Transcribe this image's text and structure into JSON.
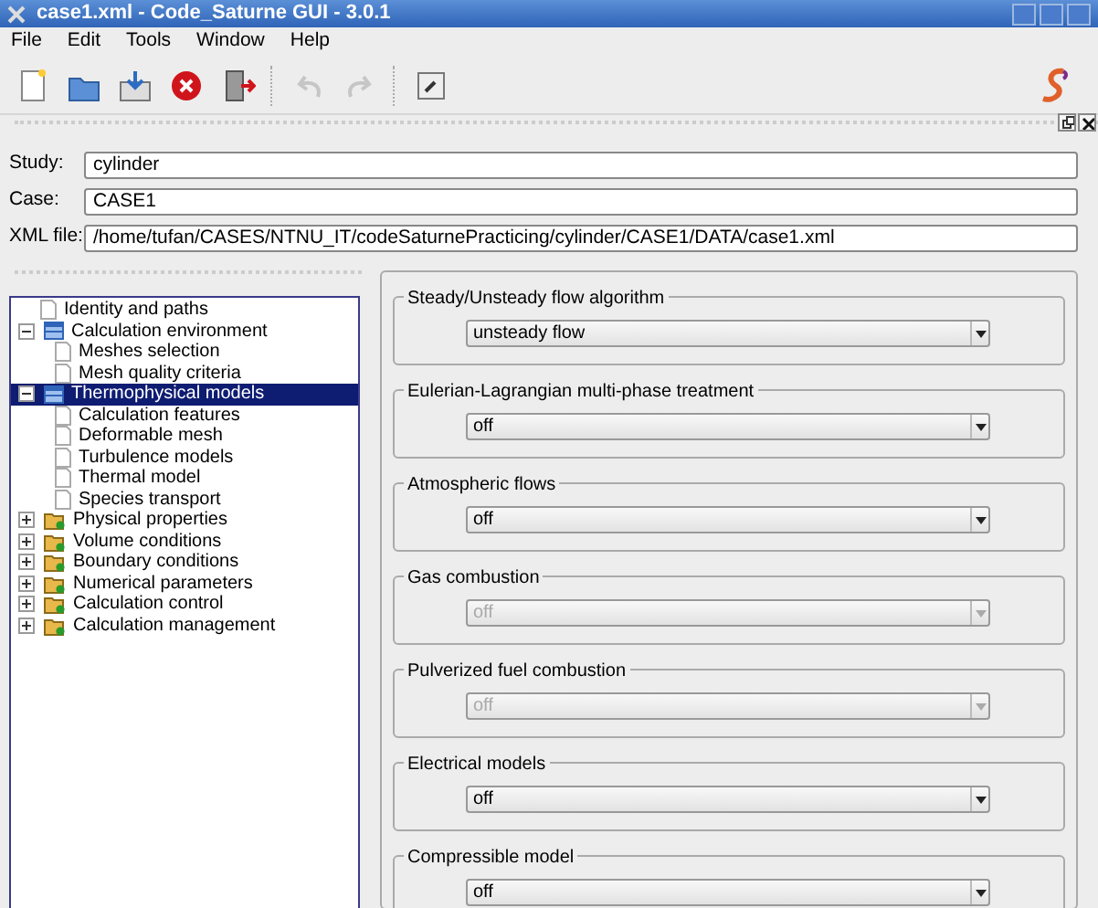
{
  "window": {
    "title": "case1.xml - Code_Saturne GUI - 3.0.1"
  },
  "menu": [
    "File",
    "Edit",
    "Tools",
    "Window",
    "Help"
  ],
  "toolbar": [
    {
      "kind": "new",
      "disabled": false
    },
    {
      "kind": "open",
      "disabled": false
    },
    {
      "kind": "save",
      "disabled": false
    },
    {
      "kind": "close",
      "disabled": false
    },
    {
      "kind": "exit",
      "disabled": false
    },
    {
      "kind": "undo",
      "disabled": true
    },
    {
      "kind": "redo",
      "disabled": true
    },
    {
      "kind": "prefs",
      "disabled": false
    }
  ],
  "identity": [
    {
      "label": "Study:",
      "value": "cylinder"
    },
    {
      "label": "Case:",
      "value": "CASE1"
    },
    {
      "label": "XML file:",
      "value": "/home/tufan/CASES/NTNU_IT/codeSaturnePracticing/cylinder/CASE1/DATA/case1.xml"
    }
  ],
  "tree": [
    {
      "label": "Identity and paths",
      "kind": "page",
      "selected": false
    },
    {
      "label": "Calculation environment",
      "kind": "section",
      "expanded": true,
      "selected": false,
      "children": [
        {
          "label": "Meshes selection",
          "kind": "page",
          "selected": false
        },
        {
          "label": "Mesh quality criteria",
          "kind": "page",
          "selected": false
        }
      ]
    },
    {
      "label": "Thermophysical models",
      "kind": "section",
      "expanded": true,
      "selected": true,
      "children": [
        {
          "label": "Calculation features",
          "kind": "page",
          "selected": false
        },
        {
          "label": "Deformable mesh",
          "kind": "page",
          "selected": false
        },
        {
          "label": "Turbulence models",
          "kind": "page",
          "selected": false
        },
        {
          "label": "Thermal model",
          "kind": "page",
          "selected": false
        },
        {
          "label": "Species transport",
          "kind": "page",
          "selected": false
        }
      ]
    },
    {
      "label": "Physical properties",
      "kind": "folder",
      "expanded": false,
      "selected": false
    },
    {
      "label": "Volume conditions",
      "kind": "folder",
      "expanded": false,
      "selected": false
    },
    {
      "label": "Boundary conditions",
      "kind": "folder",
      "expanded": false,
      "selected": false
    },
    {
      "label": "Numerical parameters",
      "kind": "folder",
      "expanded": false,
      "selected": false
    },
    {
      "label": "Calculation control",
      "kind": "folder",
      "expanded": false,
      "selected": false
    },
    {
      "label": "Calculation management",
      "kind": "folder",
      "expanded": false,
      "selected": false
    }
  ],
  "groups": [
    {
      "title": "Steady/Unsteady flow algorithm",
      "value": "unsteady flow",
      "disabled": false
    },
    {
      "title": "Eulerian-Lagrangian multi-phase treatment",
      "value": "off",
      "disabled": false
    },
    {
      "title": "Atmospheric flows",
      "value": "off",
      "disabled": false
    },
    {
      "title": "Gas combustion",
      "value": "off",
      "disabled": true
    },
    {
      "title": "Pulverized fuel combustion",
      "value": "off",
      "disabled": true
    },
    {
      "title": "Electrical models",
      "value": "off",
      "disabled": false
    },
    {
      "title": "Compressible model",
      "value": "off",
      "disabled": false
    }
  ]
}
